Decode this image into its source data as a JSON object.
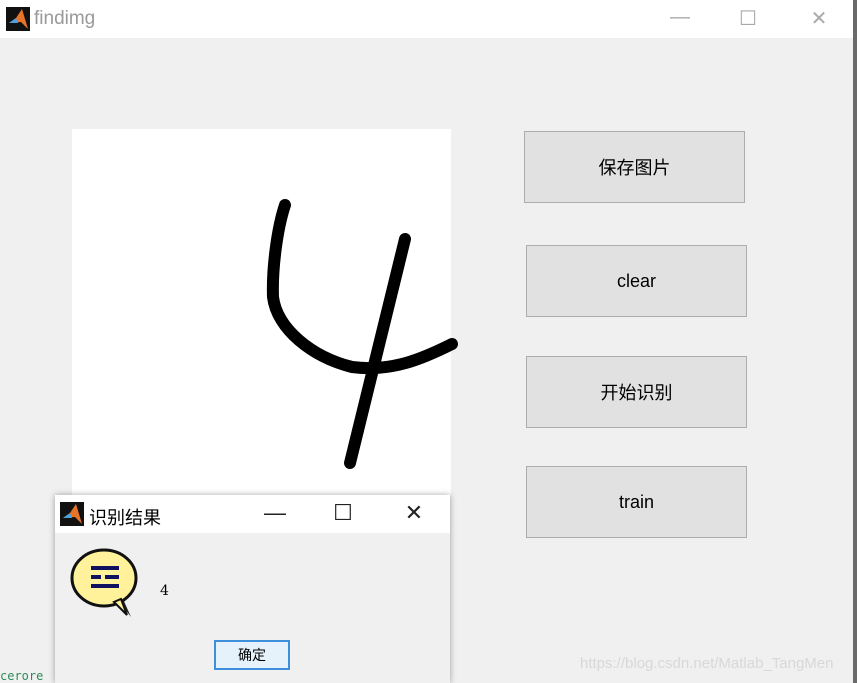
{
  "window": {
    "title": "findimg",
    "icon": "matlab-logo-icon",
    "controls": [
      "minimize-icon",
      "maximize-icon",
      "close-icon"
    ]
  },
  "drawing": {
    "digit_drawn": "4",
    "stroke_color": "#000000",
    "background": "#ffffff"
  },
  "buttons": {
    "save": "保存图片",
    "clear": "clear",
    "recognize": "开始识别",
    "train": "train"
  },
  "dialog": {
    "title": "识别结果",
    "icon": "help-speech-bubble-icon",
    "message": "4",
    "ok_label": "确定",
    "accent": "#3c8fd8"
  },
  "watermark": "https://blog.csdn.net/Matlab_TangMen",
  "background_text": "cerore"
}
